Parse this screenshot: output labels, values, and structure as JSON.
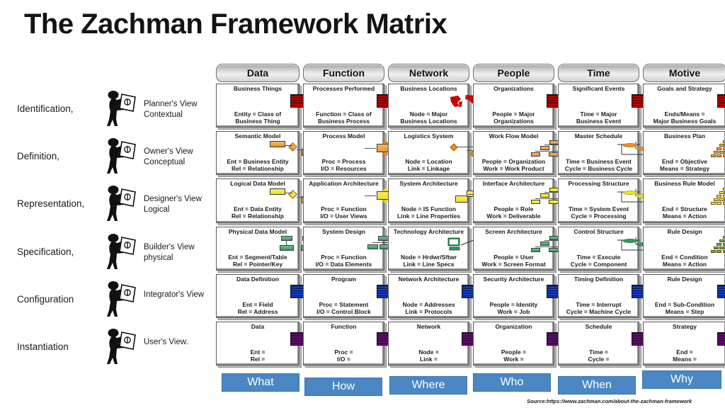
{
  "title": "The Zachman Framework Matrix",
  "source": "Source:https://www.zachman.com/about-the-zachman-framework",
  "columns": [
    {
      "header": "Data",
      "interrogative": "What"
    },
    {
      "header": "Function",
      "interrogative": "How"
    },
    {
      "header": "Network",
      "interrogative": "Where"
    },
    {
      "header": "People",
      "interrogative": "Who"
    },
    {
      "header": "Time",
      "interrogative": "When"
    },
    {
      "header": "Motive",
      "interrogative": "Why"
    }
  ],
  "perspectives": [
    {
      "stage": "Identification,",
      "view": "Planner's View",
      "level": "Contextual",
      "figure": "planner-figure"
    },
    {
      "stage": "Definition,",
      "view": "Owner's View",
      "level": "Conceptual",
      "figure": "owner-figure"
    },
    {
      "stage": "Representation,",
      "view": "Designer's View",
      "level": "Logical",
      "figure": "designer-figure"
    },
    {
      "stage": "Specification,",
      "view": "Builder's View",
      "level": "physical",
      "figure": "builder-figure"
    },
    {
      "stage": "Configuration",
      "view": "Integrator's View",
      "level": "",
      "figure": "integrator-figure"
    },
    {
      "stage": "Instantiation",
      "view": "User's View.",
      "level": "",
      "figure": "user-figure"
    }
  ],
  "rows": [
    {
      "name": "contextual",
      "color": "#cc0000",
      "cells": [
        {
          "title": "Business Things",
          "art": "doc",
          "l1": "Entity = Class of",
          "l2": "Business Thing"
        },
        {
          "title": "Processes Performed",
          "art": "doc",
          "l1": "Function = Class of",
          "l2": "Business Process"
        },
        {
          "title": "Business Locations",
          "art": "map",
          "l1": "Node = Major",
          "l2": "Business Locations"
        },
        {
          "title": "Organizations",
          "art": "doc",
          "l1": "People = Major",
          "l2": "Organizations"
        },
        {
          "title": "Significant Events",
          "art": "doc",
          "l1": "Time = Major",
          "l2": "Business Event"
        },
        {
          "title": "Goals and Strategy",
          "art": "doc",
          "l1": "Ends/Means =",
          "l2": "Major Business Goals"
        }
      ]
    },
    {
      "name": "conceptual",
      "color": "#f0901e",
      "cells": [
        {
          "title": "Semantic Model",
          "art": "er",
          "l1": "Ent = Business Entity",
          "l2": "Rel = Relationship"
        },
        {
          "title": "Process Model",
          "art": "process",
          "l1": "Proc = Process",
          "l2": "I/O = Resources"
        },
        {
          "title": "Logistics System",
          "art": "network",
          "l1": "Node = Location",
          "l2": "Link = Linkage"
        },
        {
          "title": "Work Flow Model",
          "art": "org",
          "l1": "People = Organization",
          "l2": "Work = Work Product"
        },
        {
          "title": "Master Schedule",
          "art": "schedule",
          "l1": "Time = Business Event",
          "l2": "Cycle = Business Cycle"
        },
        {
          "title": "Business Plan",
          "art": "pyramid",
          "l1": "End = Objective",
          "l2": "Means = Strategy"
        }
      ]
    },
    {
      "name": "logical",
      "color": "#f2e215",
      "cells": [
        {
          "title": "Logical Data Model",
          "art": "er",
          "l1": "Ent = Data Entity",
          "l2": "Rel = Relationship"
        },
        {
          "title": "Application Architecture",
          "art": "process",
          "l1": "Proc = Function",
          "l2": "I/O = User Views"
        },
        {
          "title": "System Architecture",
          "art": "sysarch",
          "l1": "Node = IS Function",
          "l2": "Link = Line Properties"
        },
        {
          "title": "Interface  Architecture",
          "art": "org",
          "l1": "People = Role",
          "l2": "Work = Deliverable"
        },
        {
          "title": "Processing Structure",
          "art": "schedule",
          "l1": "Time = System Event",
          "l2": "Cycle = Processing"
        },
        {
          "title": "Business Rule Model",
          "art": "pyramid",
          "l1": "End = Structure",
          "l2": "Means = Action"
        }
      ]
    },
    {
      "name": "physical",
      "color": "#2e9e5b",
      "cells": [
        {
          "title": "Physical Data Model",
          "art": "tree2",
          "l1": "Ent = Segment/Table",
          "l2": "Rel = Pointer/Key"
        },
        {
          "title": "System Design",
          "art": "tree1",
          "l1": "Proc = Function",
          "l2": "I/O = Data Elements"
        },
        {
          "title": "Technology Architecture",
          "art": "hardware",
          "l1": "Node = Hrdwr/Sftwr",
          "l2": "Link = Line Specs"
        },
        {
          "title": "Screen Architecture",
          "art": "org",
          "l1": "People = User",
          "l2": "Work = Screen Format"
        },
        {
          "title": "Control Structure",
          "art": "schedule",
          "l1": "Time = Execute",
          "l2": "Cycle = Component"
        },
        {
          "title": "Rule Design",
          "art": "pyramid",
          "l1": "End = Condition",
          "l2": "Means = Action"
        }
      ]
    },
    {
      "name": "detailed",
      "color": "#1740cc",
      "cells": [
        {
          "title": "Data Definition",
          "art": "doc",
          "l1": "Ent = Field",
          "l2": "Rel = Address"
        },
        {
          "title": "Program",
          "art": "doc",
          "l1": "Proc = Statement",
          "l2": "I/O = Control Block"
        },
        {
          "title": "Network Architecture",
          "art": "doc",
          "l1": "Node = Addresses",
          "l2": "Link = Protocols"
        },
        {
          "title": "Security Architecture",
          "art": "doc",
          "l1": "People = Identity",
          "l2": "Work = Job"
        },
        {
          "title": "Timing Definition",
          "art": "doc",
          "l1": "Time = Interrupt",
          "l2": "Cycle = Machine Cycle"
        },
        {
          "title": "Rule Design",
          "art": "doc",
          "l1": "End = Sub-Condition",
          "l2": "Means = Step"
        }
      ]
    },
    {
      "name": "functioning",
      "color": "#6b0d7a",
      "cells": [
        {
          "title": "Data",
          "art": "doc",
          "l1": "Ent =",
          "l2": "Rel ="
        },
        {
          "title": "Function",
          "art": "doc",
          "l1": "Proc =",
          "l2": "I/O ="
        },
        {
          "title": "Network",
          "art": "doc",
          "l1": "Node =",
          "l2": "Link ="
        },
        {
          "title": "Organization",
          "art": "doc",
          "l1": "People =",
          "l2": "Work ="
        },
        {
          "title": "Schedule",
          "art": "doc",
          "l1": "Time =",
          "l2": "Cycle ="
        },
        {
          "title": "Strategy",
          "art": "doc",
          "l1": "End =",
          "l2": "Means ="
        }
      ]
    }
  ]
}
